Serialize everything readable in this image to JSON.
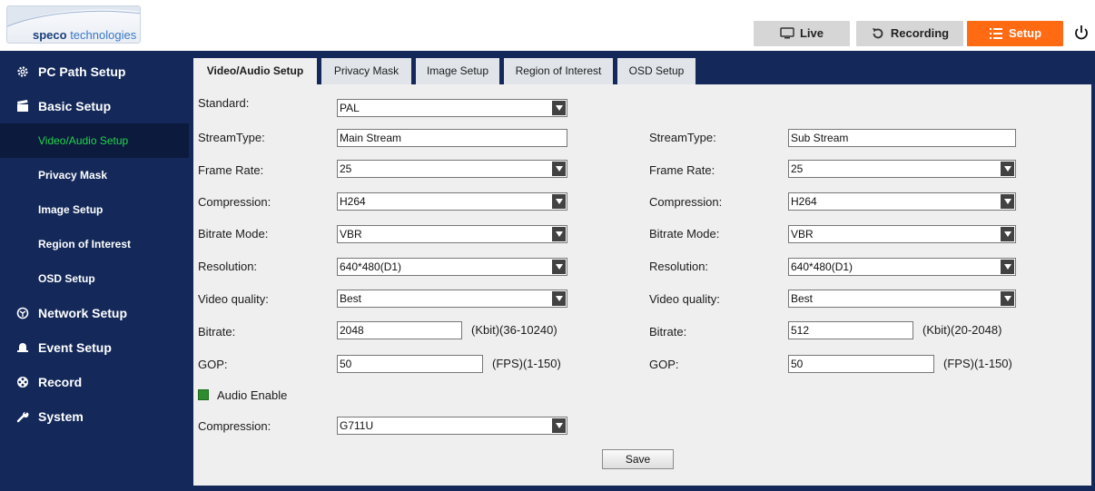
{
  "brand": {
    "prefix": "speco",
    "suffix": " technologies"
  },
  "topnav": {
    "live": "Live",
    "recording": "Recording",
    "setup": "Setup"
  },
  "sidebar": {
    "pc_path": "PC Path Setup",
    "basic": "Basic Setup",
    "sub": [
      "Video/Audio Setup",
      "Privacy Mask",
      "Image Setup",
      "Region of Interest",
      "OSD Setup"
    ],
    "network": "Network Setup",
    "event": "Event Setup",
    "record": "Record",
    "system": "System"
  },
  "tabs": [
    "Video/Audio Setup",
    "Privacy Mask",
    "Image Setup",
    "Region of Interest",
    "OSD Setup"
  ],
  "form": {
    "standard_label": "Standard:",
    "standard_value": "PAL",
    "left": {
      "streamtype_label": "StreamType:",
      "streamtype_value": "Main Stream",
      "framerate_label": "Frame Rate:",
      "framerate_value": "25",
      "compression_label": "Compression:",
      "compression_value": "H264",
      "bitratemode_label": "Bitrate Mode:",
      "bitratemode_value": "VBR",
      "resolution_label": "Resolution:",
      "resolution_value": "640*480(D1)",
      "quality_label": "Video quality:",
      "quality_value": "Best",
      "bitrate_label": "Bitrate:",
      "bitrate_value": "2048",
      "bitrate_hint": "(Kbit)(36-10240)",
      "gop_label": "GOP:",
      "gop_value": "50",
      "gop_hint": "(FPS)(1-150)"
    },
    "right": {
      "streamtype_label": "StreamType:",
      "streamtype_value": "Sub Stream",
      "framerate_label": "Frame Rate:",
      "framerate_value": "25",
      "compression_label": "Compression:",
      "compression_value": "H264",
      "bitratemode_label": "Bitrate Mode:",
      "bitratemode_value": "VBR",
      "resolution_label": "Resolution:",
      "resolution_value": "640*480(D1)",
      "quality_label": "Video quality:",
      "quality_value": "Best",
      "bitrate_label": "Bitrate:",
      "bitrate_value": "512",
      "bitrate_hint": "(Kbit)(20-2048)",
      "gop_label": "GOP:",
      "gop_value": "50",
      "gop_hint": "(FPS)(1-150)"
    },
    "audio_enable_label": "Audio Enable",
    "audio_enabled": true,
    "audio_compression_label": "Compression:",
    "audio_compression_value": "G711U",
    "save_label": "Save"
  },
  "colors": {
    "navy": "#14295a",
    "orange": "#ff6a13",
    "active_green": "#20d64a",
    "panel": "#efefef"
  }
}
